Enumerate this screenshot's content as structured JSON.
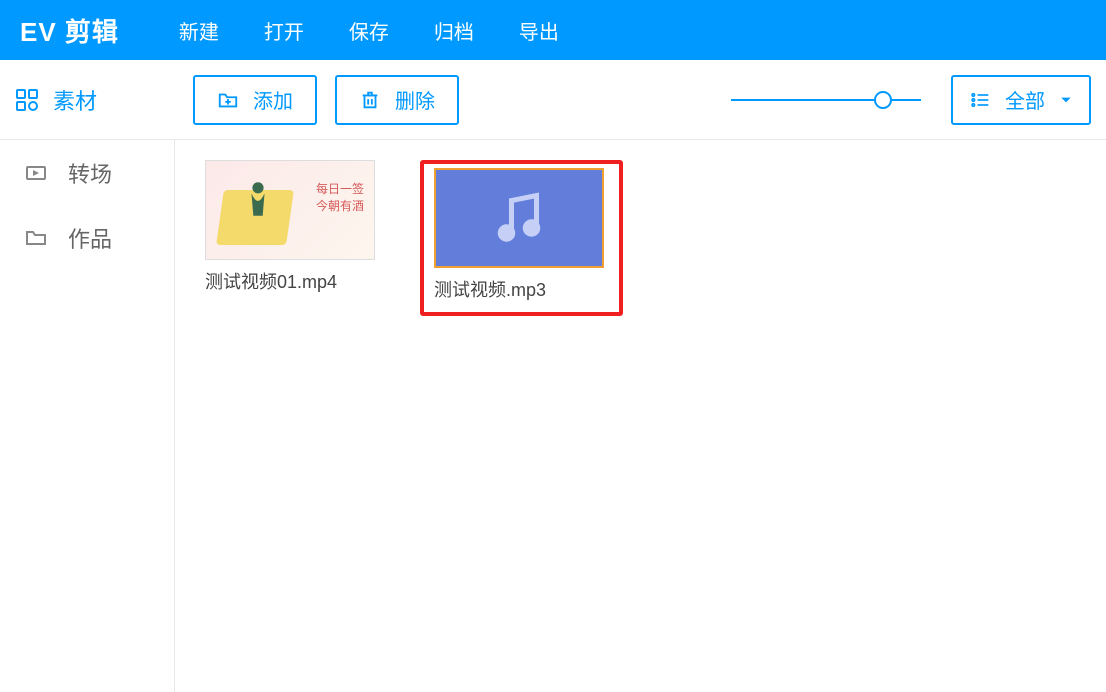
{
  "app": {
    "title": "EV 剪辑"
  },
  "menu": {
    "new": "新建",
    "open": "打开",
    "save": "保存",
    "archive": "归档",
    "export": "导出"
  },
  "toolbar": {
    "active_tab": "素材",
    "add": "添加",
    "delete": "删除",
    "filter_selected": "全部"
  },
  "sidebar": {
    "items": [
      {
        "label": "转场",
        "icon": "transition-icon"
      },
      {
        "label": "作品",
        "icon": "folder-icon"
      }
    ]
  },
  "assets": [
    {
      "label": "测试视频01.mp4",
      "type": "video",
      "highlighted": false
    },
    {
      "label": "测试视频.mp3",
      "type": "audio",
      "highlighted": true
    }
  ],
  "colors": {
    "primary": "#0099ff",
    "highlight": "#f02020",
    "audio_thumb": "#637eda"
  }
}
